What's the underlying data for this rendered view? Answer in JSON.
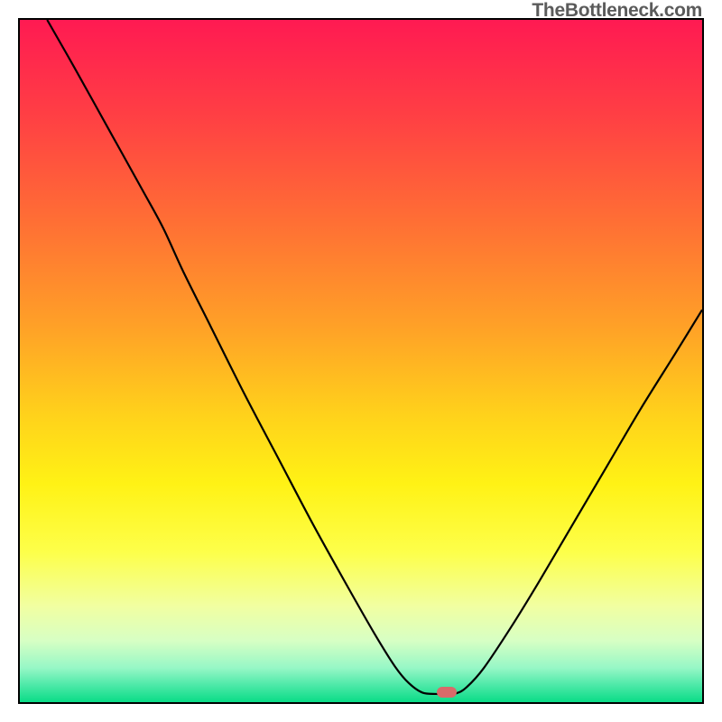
{
  "attribution": "TheBottleneck.com",
  "chart_data": {
    "type": "line",
    "title": "",
    "xlabel": "",
    "ylabel": "",
    "xlim": [
      0,
      100
    ],
    "ylim": [
      0,
      100
    ],
    "gradient_stops": [
      {
        "offset": 0,
        "color": "#ff1a52"
      },
      {
        "offset": 14,
        "color": "#ff3f44"
      },
      {
        "offset": 30,
        "color": "#ff7034"
      },
      {
        "offset": 45,
        "color": "#ffa127"
      },
      {
        "offset": 58,
        "color": "#ffd21b"
      },
      {
        "offset": 68,
        "color": "#fff215"
      },
      {
        "offset": 78,
        "color": "#fdff4a"
      },
      {
        "offset": 86,
        "color": "#f1ffa2"
      },
      {
        "offset": 91,
        "color": "#d7ffc4"
      },
      {
        "offset": 95,
        "color": "#96f7c6"
      },
      {
        "offset": 97.5,
        "color": "#4de9a8"
      },
      {
        "offset": 100,
        "color": "#0adc87"
      }
    ],
    "series": [
      {
        "name": "bottleneck-curve",
        "points": [
          {
            "x": 4.0,
            "y": 100.0
          },
          {
            "x": 8.0,
            "y": 93.0
          },
          {
            "x": 13.0,
            "y": 84.0
          },
          {
            "x": 18.0,
            "y": 75.0
          },
          {
            "x": 21.0,
            "y": 69.5
          },
          {
            "x": 24.0,
            "y": 63.0
          },
          {
            "x": 28.0,
            "y": 55.0
          },
          {
            "x": 33.0,
            "y": 45.0
          },
          {
            "x": 38.0,
            "y": 35.5
          },
          {
            "x": 43.0,
            "y": 26.0
          },
          {
            "x": 48.0,
            "y": 17.0
          },
          {
            "x": 52.0,
            "y": 10.0
          },
          {
            "x": 55.0,
            "y": 5.2
          },
          {
            "x": 57.0,
            "y": 2.8
          },
          {
            "x": 59.0,
            "y": 1.4
          },
          {
            "x": 61.0,
            "y": 1.2
          },
          {
            "x": 62.5,
            "y": 1.2
          },
          {
            "x": 64.0,
            "y": 1.3
          },
          {
            "x": 65.5,
            "y": 2.2
          },
          {
            "x": 68.0,
            "y": 5.0
          },
          {
            "x": 72.0,
            "y": 11.0
          },
          {
            "x": 76.0,
            "y": 17.5
          },
          {
            "x": 81.0,
            "y": 26.0
          },
          {
            "x": 86.0,
            "y": 34.5
          },
          {
            "x": 91.0,
            "y": 43.0
          },
          {
            "x": 96.0,
            "y": 51.0
          },
          {
            "x": 100.0,
            "y": 57.5
          }
        ]
      }
    ],
    "marker": {
      "x": 62.5,
      "y": 1.4,
      "color": "#d86a6a"
    }
  }
}
